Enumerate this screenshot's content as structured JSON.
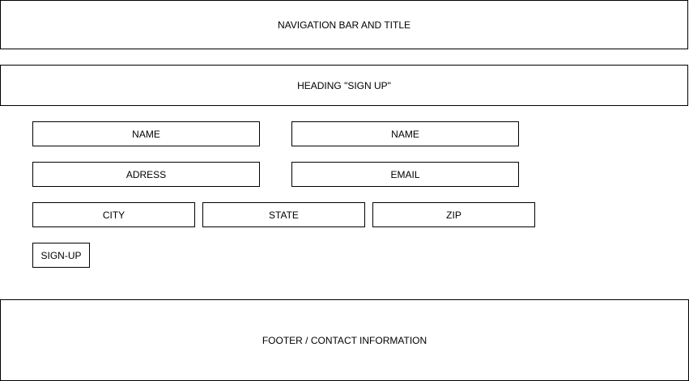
{
  "header": {
    "label": "NAVIGATION BAR AND TITLE"
  },
  "heading": {
    "label": "HEADING \"SIGN UP\""
  },
  "form": {
    "first_name_label": "NAME",
    "last_name_label": "NAME",
    "address_label": "ADRESS",
    "email_label": "EMAIL",
    "city_label": "CITY",
    "state_label": "STATE",
    "zip_label": "ZIP",
    "signup_label": "SIGN-UP"
  },
  "footer": {
    "label": "FOOTER / CONTACT INFORMATION"
  }
}
